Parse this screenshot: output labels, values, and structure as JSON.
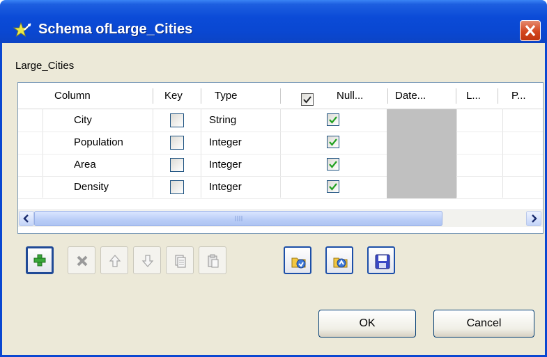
{
  "window": {
    "title": "Schema ofLarge_Cities"
  },
  "schema_label": "Large_Cities",
  "table": {
    "headers": {
      "column": "Column",
      "key": "Key",
      "type": "Type",
      "nullable": "Null...",
      "date": "Date...",
      "length": "L...",
      "precision": "P..."
    },
    "header_nullable_checked": true,
    "rows": [
      {
        "column": "City",
        "key": false,
        "type": "String",
        "nullable": true
      },
      {
        "column": "Population",
        "key": false,
        "type": "Integer",
        "nullable": true
      },
      {
        "column": "Area",
        "key": false,
        "type": "Integer",
        "nullable": true
      },
      {
        "column": "Density",
        "key": false,
        "type": "Integer",
        "nullable": true
      }
    ]
  },
  "toolbar": {
    "items": [
      {
        "icon": "add-icon",
        "enabled": true
      },
      {
        "icon": "delete-icon",
        "enabled": false
      },
      {
        "icon": "move-up-icon",
        "enabled": false
      },
      {
        "icon": "move-down-icon",
        "enabled": false
      },
      {
        "icon": "copy-icon",
        "enabled": false
      },
      {
        "icon": "paste-icon",
        "enabled": false
      },
      {
        "icon": "import-icon",
        "enabled": true
      },
      {
        "icon": "export-icon",
        "enabled": true
      },
      {
        "icon": "save-icon",
        "enabled": true
      }
    ]
  },
  "buttons": {
    "ok": "OK",
    "cancel": "Cancel"
  },
  "colors": {
    "titlebar": "#0a47d1",
    "dialog_bg": "#ece9d8",
    "check_green": "#21a121",
    "close_red": "#d3461e"
  }
}
